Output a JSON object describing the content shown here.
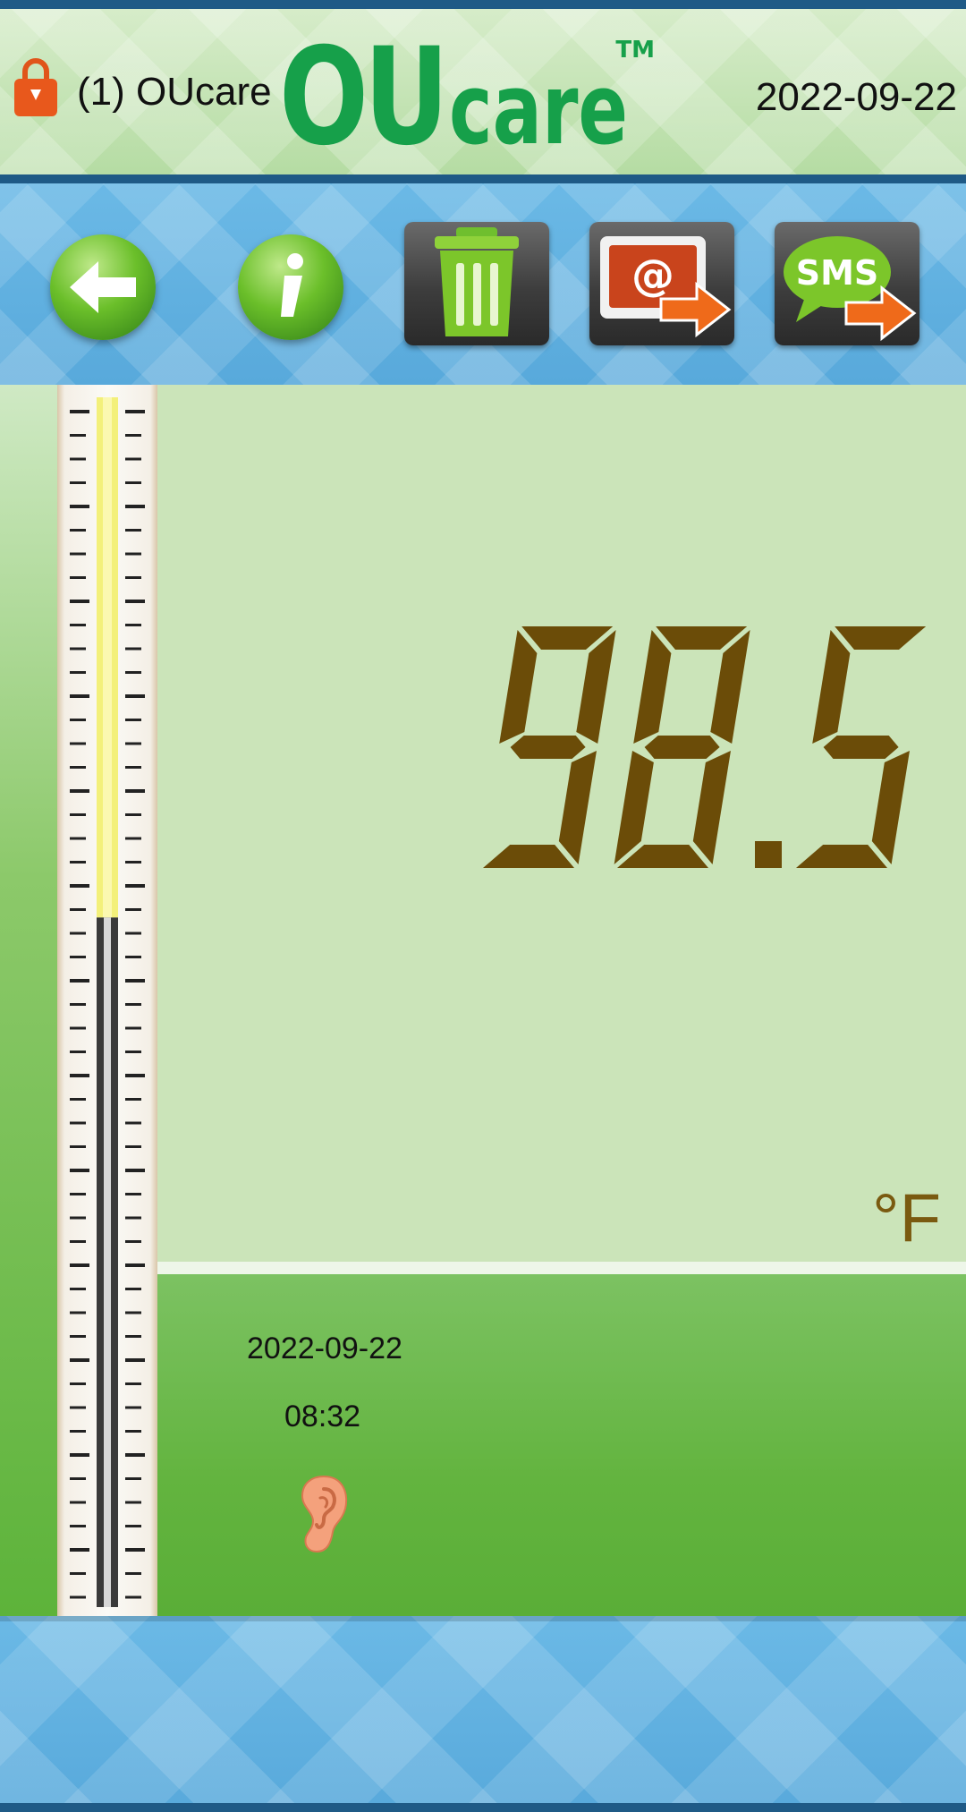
{
  "header": {
    "user_label": "(1) OUcare",
    "brand": "OUcare",
    "trademark": "TM",
    "date": "2022-09-22",
    "lock_icon": "lock-icon"
  },
  "toolbar": {
    "buttons": [
      {
        "name": "back",
        "icon": "arrow-left-icon"
      },
      {
        "name": "info",
        "icon": "info-icon"
      },
      {
        "name": "delete",
        "icon": "trash-icon"
      },
      {
        "name": "email",
        "icon": "email-export-icon",
        "label": "@"
      },
      {
        "name": "sms",
        "icon": "sms-export-icon",
        "label": "SMS"
      }
    ]
  },
  "reading": {
    "value": "98.5",
    "unit": "°F",
    "color": "#6b4c08"
  },
  "thermometer": {
    "mercury_fill_fraction": 0.57
  },
  "record": {
    "date": "2022-09-22",
    "time": "08:32",
    "mode_icon": "ear-icon"
  },
  "colors": {
    "display_bg": "#cbe4b9",
    "info_bg": "#63b43f",
    "toolbar_bg": "#5fb0e0",
    "header_bg": "#c6e4b5"
  }
}
